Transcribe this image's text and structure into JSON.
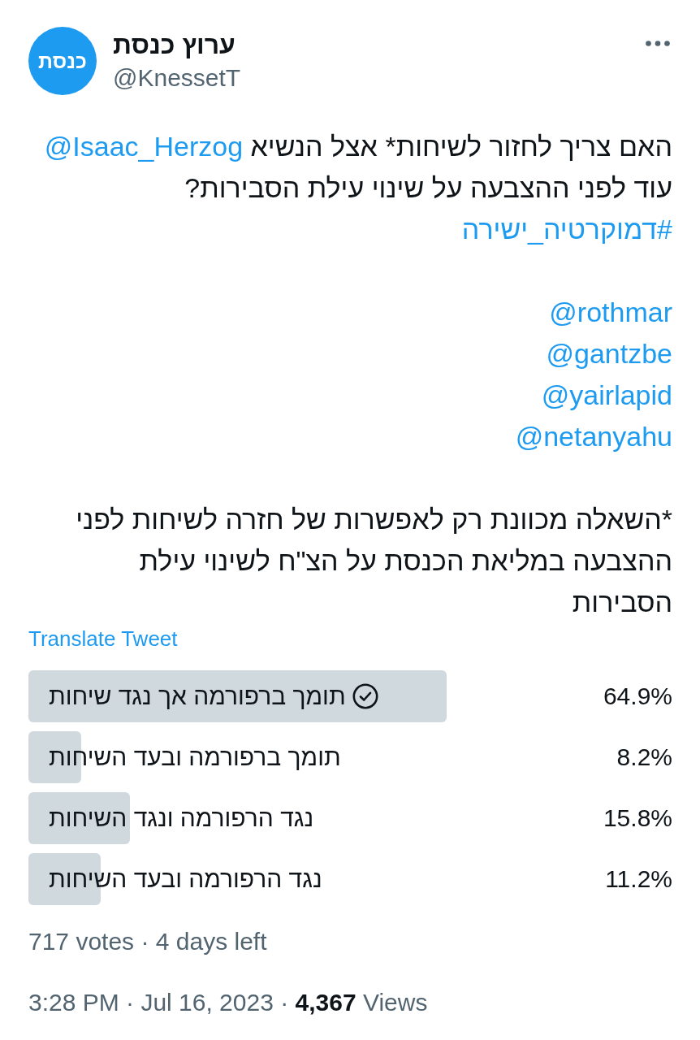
{
  "author": {
    "avatar_text": "כנסת",
    "name": "ערוץ כנסת",
    "handle": "@KnessetT"
  },
  "tweet": {
    "blocks": [
      {
        "lines": [
          [
            {
              "kind": "text",
              "text": "האם צריך לחזור לשיחות* אצל הנשיא "
            },
            {
              "kind": "mention",
              "text": "@Isaac_Herzog"
            },
            {
              "kind": "text",
              "text": " עוד לפני ההצבעה על שינוי עילת הסבירות?"
            }
          ],
          [
            {
              "kind": "hashtag",
              "text": "#דמוקרטיה_ישירה"
            }
          ]
        ]
      },
      {
        "lines": [
          [
            {
              "kind": "mention",
              "text": "@rothmar"
            }
          ],
          [
            {
              "kind": "mention",
              "text": "@gantzbe"
            }
          ],
          [
            {
              "kind": "mention",
              "text": "@yairlapid"
            }
          ],
          [
            {
              "kind": "mention",
              "text": "@netanyahu"
            }
          ]
        ]
      },
      {
        "lines": [
          [
            {
              "kind": "text",
              "text": "*השאלה מכוונת רק לאפשרות של חזרה לשיחות לפני ההצבעה במליאת הכנסת על הצ\"ח לשינוי עילת הסבירות"
            }
          ]
        ]
      }
    ],
    "translate": "Translate Tweet"
  },
  "poll": {
    "options": [
      {
        "label": "תומך ברפורמה אך נגד שיחות",
        "percent": "64.9%",
        "level": 0.649,
        "selected": true
      },
      {
        "label": "תומך ברפורמה ובעד השיחות",
        "percent": "8.2%",
        "level": 0.082,
        "selected": false
      },
      {
        "label": "נגד הרפורמה ונגד השיחות",
        "percent": "15.8%",
        "level": 0.158,
        "selected": false
      },
      {
        "label": "נגד הרפורמה ובעד השיחות",
        "percent": "11.2%",
        "level": 0.112,
        "selected": false
      }
    ],
    "summary": "717 votes · 4 days left"
  },
  "meta": {
    "timestamp": "3:28 PM · Jul 16, 2023 · **4,367** Views"
  }
}
